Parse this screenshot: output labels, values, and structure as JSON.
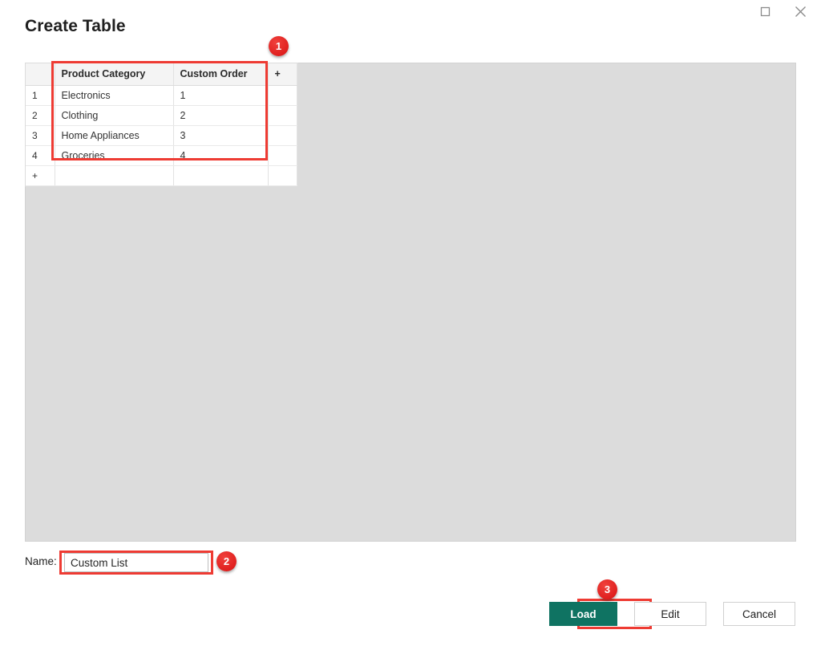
{
  "window": {
    "title": "Create Table",
    "controls": [
      {
        "name": "maximize",
        "icon": "square-icon",
        "label": "□"
      },
      {
        "name": "close",
        "icon": "close-icon",
        "label": "✕"
      }
    ]
  },
  "grid": {
    "row_header_label": "",
    "add_column_label": "+",
    "add_row_label": "+",
    "columns": [
      "Product Category",
      "Custom Order"
    ],
    "rows": [
      {
        "index": "1",
        "category": "Electronics",
        "order": "1"
      },
      {
        "index": "2",
        "category": "Clothing",
        "order": "2"
      },
      {
        "index": "3",
        "category": "Home Appliances",
        "order": "3"
      },
      {
        "index": "4",
        "category": "Groceries",
        "order": "4"
      }
    ]
  },
  "name_field": {
    "label": "Name:",
    "value": "Custom List",
    "placeholder": ""
  },
  "footer": {
    "load_label": "Load",
    "edit_label": "Edit",
    "cancel_label": "Cancel"
  },
  "annotations": {
    "badges": [
      {
        "id": "1",
        "text": "1",
        "target": "grid-table"
      },
      {
        "id": "2",
        "text": "2",
        "target": "name-input"
      },
      {
        "id": "3",
        "text": "3",
        "target": "load-button"
      }
    ],
    "highlight_color": "#ee3b33"
  },
  "colors": {
    "accent": "#0f7362",
    "annotation": "#ee3b33",
    "canvas": "#dcdcdc",
    "header_row": "#f4f4f4"
  }
}
